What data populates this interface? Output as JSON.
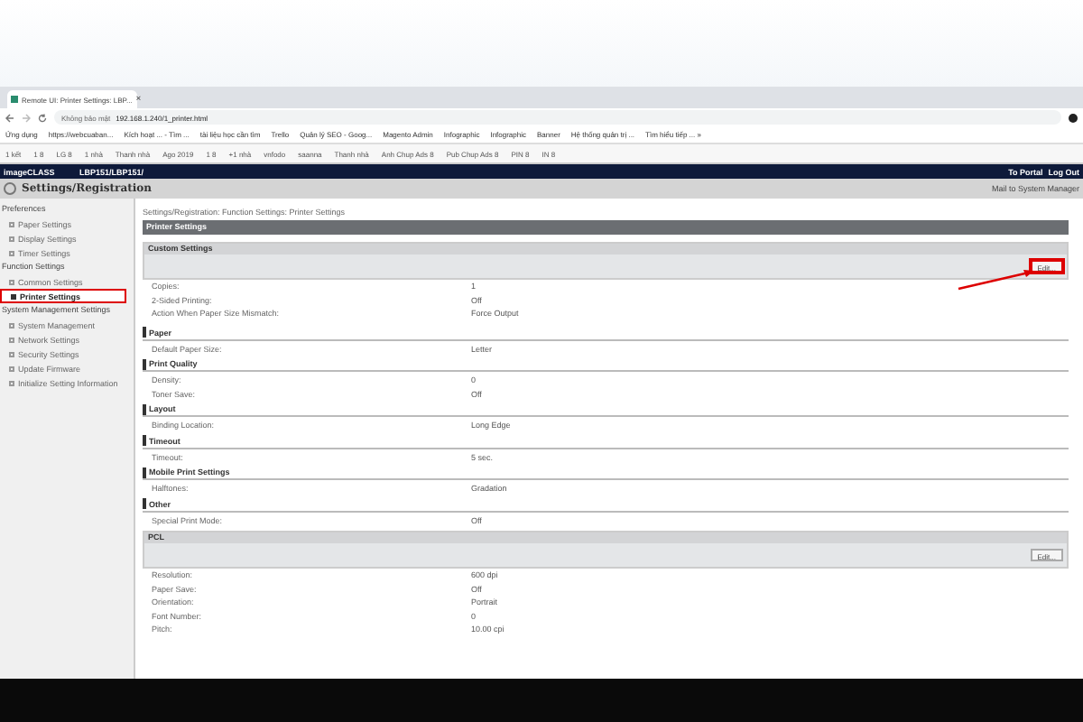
{
  "browser": {
    "tab_title": "Remote UI: Printer Settings: LBP...",
    "tab_close": "×",
    "address_security": "Không bảo mật",
    "address_url": "192.168.1.240/1_printer.html",
    "bookmarks": [
      "Ứng dụng",
      "https://webcuaban...",
      "Kích hoạt ... - Tìm ...",
      "tài liệu học cần tìm",
      "Trello",
      "Quản lý SEO - Goog...",
      "Magento Admin",
      "Infographic",
      "Infographic",
      "Banner",
      "Hệ thống quản trị ...",
      "Tìm hiểu tiếp ... »"
    ],
    "toolbar_items": [
      "1 kết",
      "1 8",
      "LG 8",
      "1 nhà",
      "Thanh nhà",
      "Ago 2019",
      "1 8",
      "+1 nhà",
      "vnfodo",
      "saanna",
      "Thanh nhà",
      "Anh Chup Ads 8",
      "Pub Chup Ads 8",
      "PIN 8",
      "IN 8"
    ]
  },
  "header": {
    "product": "imageCLASS",
    "model": "LBP151/LBP151/",
    "links": [
      "To Portal",
      "Log Out"
    ],
    "page_title": "Settings/Registration",
    "mail_link": "Mail to System Manager"
  },
  "sidebar": [
    {
      "title": "Preferences",
      "items": [
        {
          "label": "Paper Settings",
          "selected": false,
          "annotated": false
        },
        {
          "label": "Display Settings",
          "selected": false,
          "annotated": false
        },
        {
          "label": "Timer Settings",
          "selected": false,
          "annotated": false
        }
      ]
    },
    {
      "title": "Function Settings",
      "items": [
        {
          "label": "Common Settings",
          "selected": false,
          "annotated": false
        },
        {
          "label": "Printer Settings",
          "selected": true,
          "annotated": true
        }
      ]
    },
    {
      "title": "System Management Settings",
      "items": [
        {
          "label": "System Management",
          "selected": false,
          "annotated": false
        },
        {
          "label": "Network Settings",
          "selected": false,
          "annotated": false
        },
        {
          "label": "Security Settings",
          "selected": false,
          "annotated": false
        },
        {
          "label": "Update Firmware",
          "selected": false,
          "annotated": false
        },
        {
          "label": "Initialize Setting Information",
          "selected": false,
          "annotated": false
        }
      ]
    }
  ],
  "breadcrumb": "Settings/Registration: Function Settings: Printer Settings",
  "page_heading": "Printer Settings",
  "sections": [
    {
      "kind": "panel",
      "title": "Custom Settings",
      "button": "Edit...",
      "annotated": true,
      "rows": [
        {
          "label": "Copies:",
          "value": "1"
        },
        {
          "label": "2-Sided Printing:",
          "value": "Off"
        },
        {
          "label": "Action When Paper Size Mismatch:",
          "value": "Force Output"
        }
      ]
    },
    {
      "kind": "heading",
      "title": "Paper",
      "rows": [
        {
          "label": "Default Paper Size:",
          "value": "Letter"
        }
      ]
    },
    {
      "kind": "heading",
      "title": "Print Quality",
      "rows": [
        {
          "label": "Density:",
          "value": "0"
        },
        {
          "label": "Toner Save:",
          "value": "Off"
        }
      ]
    },
    {
      "kind": "heading",
      "title": "Layout",
      "rows": [
        {
          "label": "Binding Location:",
          "value": "Long Edge"
        }
      ]
    },
    {
      "kind": "heading",
      "title": "Timeout",
      "rows": [
        {
          "label": "Timeout:",
          "value": "5 sec."
        }
      ]
    },
    {
      "kind": "heading",
      "title": "Mobile Print Settings",
      "rows": [
        {
          "label": "Halftones:",
          "value": "Gradation"
        }
      ]
    },
    {
      "kind": "heading",
      "title": "Other",
      "rows": [
        {
          "label": "Special Print Mode:",
          "value": "Off"
        }
      ]
    },
    {
      "kind": "panel",
      "title": "PCL",
      "button": "Edit...",
      "annotated": false,
      "rows": [
        {
          "label": "Resolution:",
          "value": "600 dpi"
        },
        {
          "label": "Paper Save:",
          "value": "Off"
        },
        {
          "label": "Orientation:",
          "value": "Portrait"
        },
        {
          "label": "Font Number:",
          "value": "0"
        },
        {
          "label": "Pitch:",
          "value": "10.00 cpi"
        }
      ]
    }
  ]
}
